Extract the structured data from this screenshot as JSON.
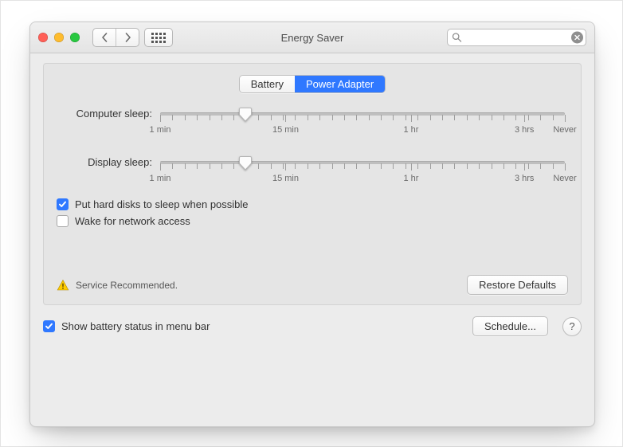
{
  "window": {
    "title": "Energy Saver",
    "search_placeholder": ""
  },
  "tabs": {
    "battery": "Battery",
    "power_adapter": "Power Adapter",
    "active": "power_adapter"
  },
  "sliders": {
    "computer": {
      "label": "Computer sleep:",
      "position_pct": 21
    },
    "display": {
      "label": "Display sleep:",
      "position_pct": 21
    },
    "tick_labels": {
      "one_min": "1 min",
      "fifteen_min": "15 min",
      "one_hr": "1 hr",
      "three_hrs": "3 hrs",
      "never": "Never"
    }
  },
  "checks": {
    "hard_disk": {
      "label": "Put hard disks to sleep when possible",
      "checked": true
    },
    "wake_net": {
      "label": "Wake for network access",
      "checked": false
    }
  },
  "service": {
    "message": "Service Recommended."
  },
  "buttons": {
    "restore": "Restore Defaults",
    "schedule": "Schedule...",
    "help": "?"
  },
  "bottom": {
    "show_status": {
      "label": "Show battery status in menu bar",
      "checked": true
    }
  }
}
